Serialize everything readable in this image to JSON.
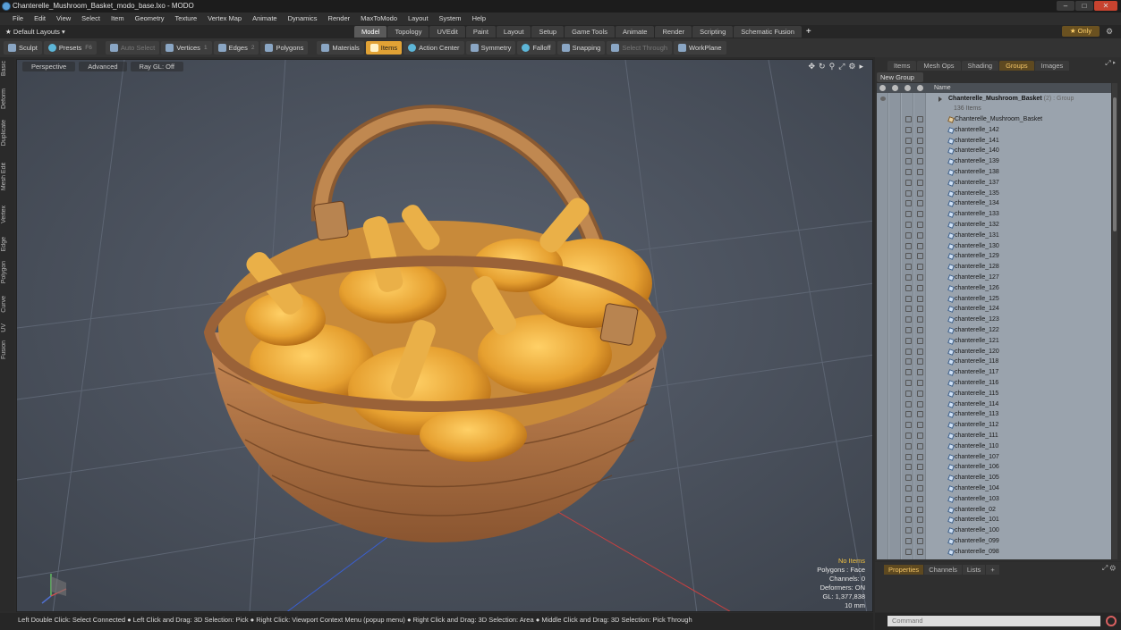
{
  "window": {
    "title": "Chanterelle_Mushroom_Basket_modo_base.lxo - MODO",
    "controls": [
      "–",
      "□",
      "✕"
    ]
  },
  "menu": [
    "File",
    "Edit",
    "View",
    "Select",
    "Item",
    "Geometry",
    "Texture",
    "Vertex Map",
    "Animate",
    "Dynamics",
    "Render",
    "MaxToModo",
    "Layout",
    "System",
    "Help"
  ],
  "layouts": {
    "selector": "Default Layouts ▾",
    "tabs": [
      {
        "label": "Model",
        "active": true
      },
      {
        "label": "Topology"
      },
      {
        "label": "UVEdit"
      },
      {
        "label": "Paint"
      },
      {
        "label": "Layout"
      },
      {
        "label": "Setup"
      },
      {
        "label": "Game Tools"
      },
      {
        "label": "Animate"
      },
      {
        "label": "Render"
      },
      {
        "label": "Scripting"
      },
      {
        "label": "Schematic Fusion"
      }
    ],
    "add_tab": "+",
    "only_label": "★ Only"
  },
  "toolbar": {
    "sculpt": "Sculpt",
    "presets": "Presets",
    "presets_key": "F6",
    "auto_select": "Auto Select",
    "vertices": "Vertices",
    "vertices_key": "1",
    "edges": "Edges",
    "edges_key": "2",
    "polygons": "Polygons",
    "polygons_key": "3",
    "materials": "Materials",
    "items": "Items",
    "action_center": "Action Center",
    "symmetry": "Symmetry",
    "falloff": "Falloff",
    "snapping": "Snapping",
    "select_through": "Select Through",
    "workplane": "WorkPlane"
  },
  "left_tabs": [
    "Basic",
    "Deform",
    "Duplicate",
    "Mesh Edit",
    "Vertex",
    "Edge",
    "Polygon",
    "Curve",
    "UV",
    "Fusion"
  ],
  "viewport": {
    "view": "Perspective",
    "shading": "Advanced",
    "raygl": "Ray GL: Off",
    "info": {
      "items": "No Items",
      "polygons": "Polygons : Face",
      "channels": "Channels: 0",
      "deformers": "Deformers: ON",
      "gl": "GL: 1,377,838",
      "scale": "10 mm"
    }
  },
  "status": "Left Double Click: Select Connected ● Left Click and Drag: 3D Selection: Pick ● Right Click: Viewport Context Menu (popup menu) ● Right Click and Drag: 3D Selection: Area ● Middle Click and Drag: 3D Selection: Pick Through",
  "right_panel": {
    "tabs": [
      {
        "label": "Items"
      },
      {
        "label": "Mesh Ops"
      },
      {
        "label": "Shading"
      },
      {
        "label": "Groups",
        "active": true
      },
      {
        "label": "Images"
      }
    ],
    "new_group": "New Group",
    "name_header": "Name",
    "group": {
      "name": "Chanterelle_Mushroom_Basket",
      "suffix": "(2) : Group",
      "count": "136 Items"
    },
    "items": [
      "Chanterelle_Mushroom_Basket",
      "chanterelle_142",
      "chanterelle_141",
      "chanterelle_140",
      "chanterelle_139",
      "chanterelle_138",
      "chanterelle_137",
      "chanterelle_135",
      "chanterelle_134",
      "chanterelle_133",
      "chanterelle_132",
      "chanterelle_131",
      "chanterelle_130",
      "chanterelle_129",
      "chanterelle_128",
      "chanterelle_127",
      "chanterelle_126",
      "chanterelle_125",
      "chanterelle_124",
      "chanterelle_123",
      "chanterelle_122",
      "chanterelle_121",
      "chanterelle_120",
      "chanterelle_118",
      "chanterelle_117",
      "chanterelle_116",
      "chanterelle_115",
      "chanterelle_114",
      "chanterelle_113",
      "chanterelle_112",
      "chanterelle_111",
      "chanterelle_110",
      "chanterelle_107",
      "chanterelle_106",
      "chanterelle_105",
      "chanterelle_104",
      "chanterelle_103",
      "chanterelle_02",
      "chanterelle_101",
      "chanterelle_100",
      "chanterelle_099",
      "chanterelle_098"
    ]
  },
  "properties": {
    "tabs": [
      {
        "label": "Properties",
        "active": true
      },
      {
        "label": "Channels"
      },
      {
        "label": "Lists"
      },
      {
        "label": "+"
      }
    ]
  },
  "command": {
    "placeholder": "Command"
  },
  "colors": {
    "accent": "#e1a235",
    "viewport_bg": "#4b5360",
    "list_bg": "#9aa3ad"
  }
}
